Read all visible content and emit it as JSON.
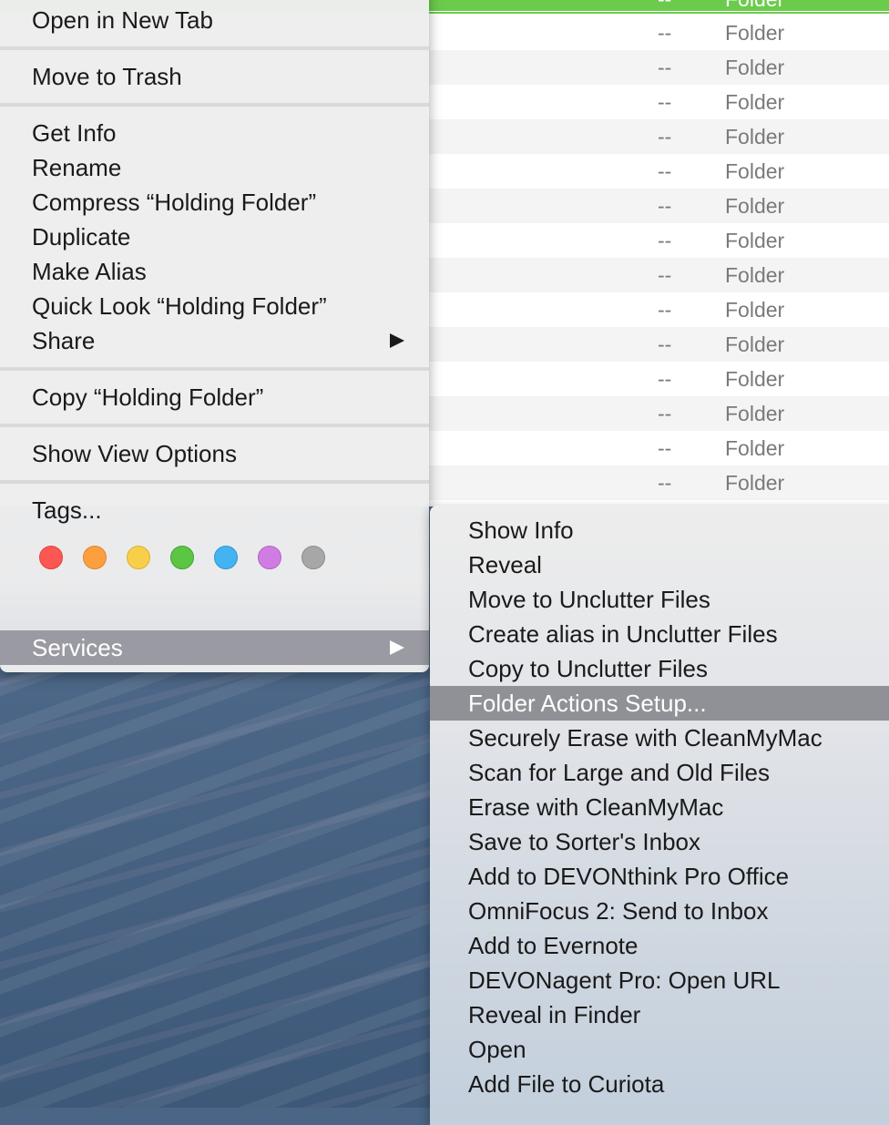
{
  "file_list": {
    "rows": [
      {
        "size": "--",
        "kind": "Folder"
      },
      {
        "size": "--",
        "kind": "Folder"
      },
      {
        "size": "--",
        "kind": "Folder"
      },
      {
        "size": "--",
        "kind": "Folder"
      },
      {
        "size": "--",
        "kind": "Folder"
      },
      {
        "size": "--",
        "kind": "Folder"
      },
      {
        "size": "--",
        "kind": "Folder"
      },
      {
        "size": "--",
        "kind": "Folder"
      },
      {
        "size": "--",
        "kind": "Folder"
      },
      {
        "size": "--",
        "kind": "Folder"
      },
      {
        "size": "--",
        "kind": "Folder"
      },
      {
        "size": "--",
        "kind": "Folder"
      },
      {
        "size": "--",
        "kind": "Folder"
      },
      {
        "size": "--",
        "kind": "Folder"
      },
      {
        "size": "--",
        "kind": "Folder"
      }
    ]
  },
  "context_menu": {
    "open_new_tab": "Open in New Tab",
    "move_to_trash": "Move to Trash",
    "get_info": "Get Info",
    "rename": "Rename",
    "compress": "Compress “Holding Folder”",
    "duplicate": "Duplicate",
    "make_alias": "Make Alias",
    "quick_look": "Quick Look “Holding Folder”",
    "share": "Share",
    "copy": "Copy “Holding Folder”",
    "show_view_options": "Show View Options",
    "tags": "Tags...",
    "services": "Services",
    "tag_colors": [
      "#fc5753",
      "#fd9f3f",
      "#f8cf4a",
      "#5cc544",
      "#44b3f1",
      "#d07de3",
      "#a7a7a7"
    ],
    "tag_borders": [
      "#e0443f",
      "#e0852b",
      "#ddb230",
      "#43a532",
      "#2c97d4",
      "#b364c6",
      "#8c8c8c"
    ]
  },
  "services_menu": {
    "items": [
      "Show Info",
      "Reveal",
      "Move to Unclutter Files",
      "Create alias in Unclutter Files",
      "Copy to Unclutter Files",
      "Folder Actions Setup...",
      "Securely Erase with CleanMyMac",
      "Scan for Large and Old Files",
      "Erase with CleanMyMac",
      "Save to Sorter's Inbox",
      "Add to DEVONthink Pro Office",
      "OmniFocus 2: Send to Inbox",
      "Add to Evernote",
      "DEVONagent Pro: Open URL",
      "Reveal in Finder",
      "Open",
      "Add File to Curiota"
    ],
    "highlighted_index": 5
  }
}
